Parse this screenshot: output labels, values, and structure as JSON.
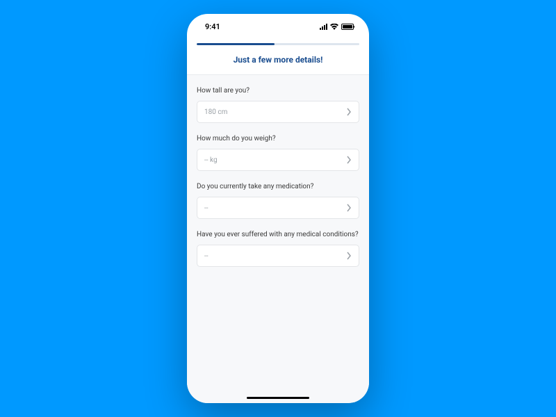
{
  "statusBar": {
    "time": "9:41"
  },
  "header": {
    "title": "Just a few more details!",
    "progressPercent": 48
  },
  "form": {
    "fields": [
      {
        "label": "How tall are you?",
        "value": "180 cm",
        "name": "height"
      },
      {
        "label": "How much do you weigh?",
        "value": "-- kg",
        "name": "weight"
      },
      {
        "label": "Do you currently take any medication?",
        "value": "--",
        "name": "medication"
      },
      {
        "label": "Have you ever suffered with any medical conditions?",
        "value": "--",
        "name": "conditions"
      }
    ]
  }
}
